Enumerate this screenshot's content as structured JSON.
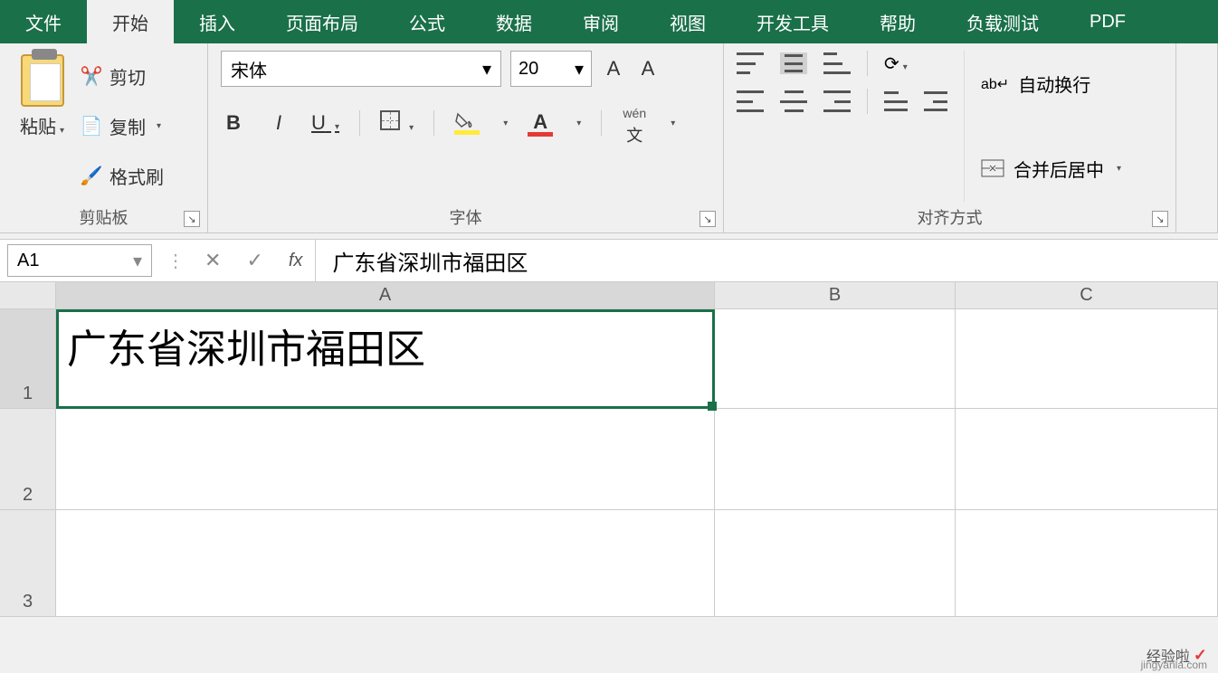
{
  "tabs": {
    "file": "文件",
    "home": "开始",
    "insert": "插入",
    "layout": "页面布局",
    "formulas": "公式",
    "data": "数据",
    "review": "审阅",
    "view": "视图",
    "dev": "开发工具",
    "help": "帮助",
    "load": "负载测试",
    "pdf": "PDF"
  },
  "clipboard": {
    "paste": "粘贴",
    "cut": "剪切",
    "copy": "复制",
    "format_painter": "格式刷",
    "group_title": "剪贴板"
  },
  "font": {
    "name": "宋体",
    "size": "20",
    "bold": "B",
    "italic": "I",
    "underline": "U",
    "bigA": "A",
    "smallA": "A",
    "colorA": "A",
    "phonetic": "wén",
    "phonetic_char": "文",
    "group_title": "字体"
  },
  "align": {
    "wrap_text": "自动换行",
    "merge_center": "合并后居中",
    "group_title": "对齐方式"
  },
  "formula_bar": {
    "name_box": "A1",
    "fx": "fx",
    "content": "广东省深圳市福田区"
  },
  "sheet": {
    "col_a": "A",
    "col_b": "B",
    "col_c": "C",
    "row1": "1",
    "row2": "2",
    "row3": "3",
    "a1": "广东省深圳市福田区"
  },
  "watermark": {
    "text": "经验啦",
    "check": "✓",
    "url": "jingyanla.com"
  }
}
